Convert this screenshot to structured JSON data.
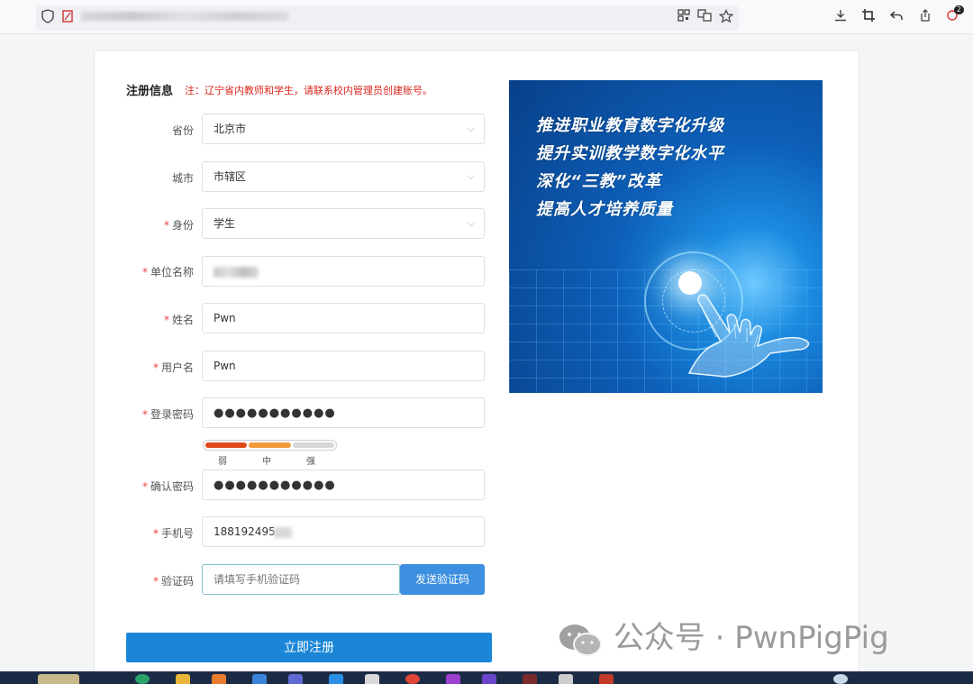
{
  "browser": {
    "toolbar_icons": [
      "shield-icon",
      "page-icon",
      "qr-icon",
      "translate-icon",
      "star-icon",
      "download-icon",
      "crop-icon",
      "undo-icon",
      "share-icon",
      "extension-icon"
    ],
    "extension_badge": "2"
  },
  "form": {
    "title": "注册信息",
    "notice": "注：辽宁省内教师和学生，请联系校内管理员创建账号。",
    "fields": {
      "province": {
        "label": "省份",
        "value": "北京市"
      },
      "city": {
        "label": "城市",
        "value": "市辖区"
      },
      "identity": {
        "label": "身份",
        "value": "学生"
      },
      "organization": {
        "label": "单位名称",
        "value": ""
      },
      "name": {
        "label": "姓名",
        "value": "Pwn"
      },
      "username": {
        "label": "用户名",
        "value": "Pwn"
      },
      "password": {
        "label": "登录密码",
        "value": "●●●●●●●●●●●"
      },
      "confirm_password": {
        "label": "确认密码",
        "value": "●●●●●●●●●●●"
      },
      "phone": {
        "label": "手机号",
        "value": "188192495"
      },
      "verify_code": {
        "label": "验证码",
        "placeholder": "请填写手机验证码"
      }
    },
    "required_mark": "*",
    "strength": {
      "weak": "弱",
      "medium": "中",
      "strong": "强",
      "level": "medium"
    },
    "send_code_label": "发送验证码",
    "submit_label": "立即注册"
  },
  "banner": {
    "lines": [
      "推进职业教育数字化升级",
      "提升实训教学数字化水平",
      "深化“三教”改革",
      "提高人才培养质量"
    ]
  },
  "watermark": {
    "text": "公众号 · PwnPigPig"
  },
  "colors": {
    "notice": "#d9261c",
    "primary": "#1b86d8",
    "send_button": "#3d8fe0",
    "strength_weak": "#e04a1b",
    "strength_medium": "#f29a3b"
  }
}
